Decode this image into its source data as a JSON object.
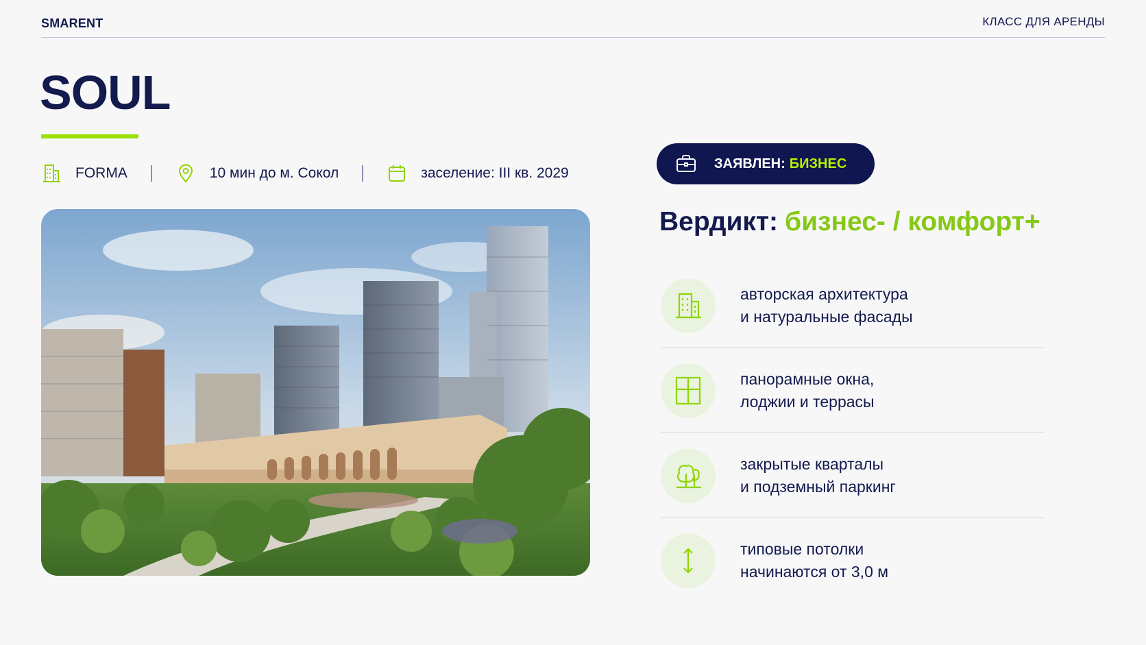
{
  "header": {
    "brand": "SMARENT",
    "class_label": "КЛАСС ДЛЯ АРЕНДЫ"
  },
  "project": {
    "title": "SOUL",
    "developer": "FORMA",
    "metro": "10 мин до м. Сокол",
    "move_in": "заселение: III кв. 2029"
  },
  "badge": {
    "prefix": "ЗАЯВЛЕН:",
    "value": "БИЗНЕС"
  },
  "verdict": {
    "label": "Вердикт:",
    "value": "бизнес- / комфорт+"
  },
  "features": [
    {
      "icon": "building-icon",
      "line1": "авторская архитектура",
      "line2": "и натуральные фасады"
    },
    {
      "icon": "window-icon",
      "line1": "панорамные окна,",
      "line2": "лоджии и террасы"
    },
    {
      "icon": "trees-icon",
      "line1": "закрытые кварталы",
      "line2": "и подземный паркинг"
    },
    {
      "icon": "height-arrow-icon",
      "line1": "типовые потолки",
      "line2": "начинаются от 3,0 м"
    }
  ],
  "colors": {
    "navy": "#131a4d",
    "accent_green": "#9ae000",
    "verdict_green": "#86c817",
    "badge_bg": "#0f1650"
  }
}
